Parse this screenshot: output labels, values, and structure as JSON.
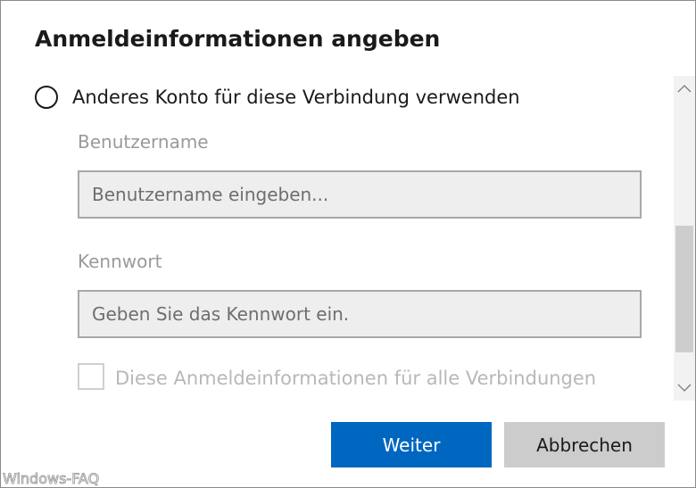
{
  "dialog": {
    "title": "Anmeldeinformationen angeben"
  },
  "options": {
    "other_account_label": "Anderes Konto für diese Verbindung verwenden"
  },
  "username": {
    "label": "Benutzername",
    "placeholder": "Benutzername eingeben...",
    "value": ""
  },
  "password": {
    "label": "Kennwort",
    "placeholder": "Geben Sie das Kennwort ein.",
    "value": ""
  },
  "remember": {
    "label": "Diese Anmeldeinformationen für alle Verbindungen",
    "label_cut": "...",
    "checked": false
  },
  "buttons": {
    "next_label": "Weiter",
    "cancel_label": "Abbrechen"
  },
  "icons": {
    "scroll_up": "chevron-up-icon",
    "scroll_down": "chevron-down-icon"
  },
  "colors": {
    "primary": "#0067c0",
    "secondary": "#cccccc"
  },
  "watermark": {
    "text": "Windows-FAQ"
  }
}
